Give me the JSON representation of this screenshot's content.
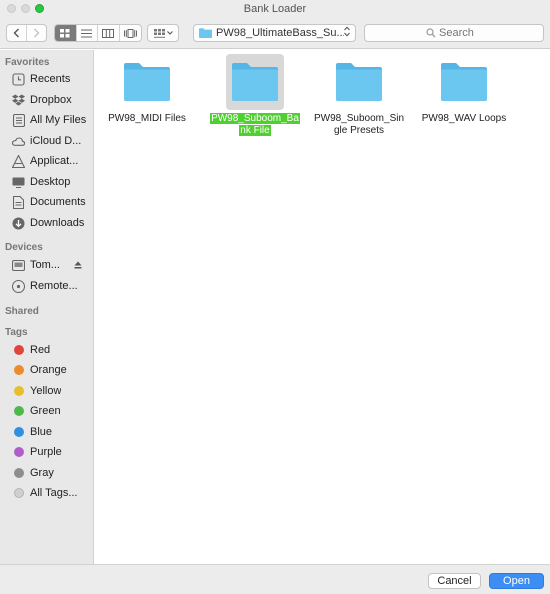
{
  "window": {
    "title": "Bank Loader"
  },
  "toolbar": {
    "back_icon": "chevron-left-icon",
    "forward_icon": "chevron-right-icon",
    "path_label": "PW98_UltimateBass_Su...",
    "search_placeholder": "Search"
  },
  "sidebar": {
    "favorites_heading": "Favorites",
    "favorites": [
      {
        "label": "Recents",
        "icon": "clock-icon"
      },
      {
        "label": "Dropbox",
        "icon": "dropbox-icon"
      },
      {
        "label": "All My Files",
        "icon": "files-icon"
      },
      {
        "label": "iCloud D...",
        "icon": "cloud-icon"
      },
      {
        "label": "Applicat...",
        "icon": "applications-icon"
      },
      {
        "label": "Desktop",
        "icon": "desktop-icon"
      },
      {
        "label": "Documents",
        "icon": "documents-icon"
      },
      {
        "label": "Downloads",
        "icon": "downloads-icon"
      }
    ],
    "devices_heading": "Devices",
    "devices": [
      {
        "label": "Tom...",
        "icon": "hard-drive-icon"
      },
      {
        "label": "Remote...",
        "icon": "disc-icon"
      }
    ],
    "shared_heading": "Shared",
    "tags_heading": "Tags",
    "tags": [
      {
        "label": "Red",
        "color": "#e0443b"
      },
      {
        "label": "Orange",
        "color": "#ed8a2b"
      },
      {
        "label": "Yellow",
        "color": "#e8be2c"
      },
      {
        "label": "Green",
        "color": "#4fb84a"
      },
      {
        "label": "Blue",
        "color": "#2f8fe0"
      },
      {
        "label": "Purple",
        "color": "#b05fc9"
      },
      {
        "label": "Gray",
        "color": "#8e8e8e"
      },
      {
        "label": "All Tags...",
        "color": "#cfcfcf"
      }
    ]
  },
  "files": [
    {
      "name_line1": "PW98_MIDI Files",
      "name_line2": "",
      "selected": false
    },
    {
      "name_line1": "PW98_Suboom_Ba",
      "name_line2": "nk File",
      "selected": true
    },
    {
      "name_line1": "PW98_Suboom_Sin",
      "name_line2": "gle Presets",
      "selected": false
    },
    {
      "name_line1": "PW98_WAV Loops",
      "name_line2": "",
      "selected": false
    }
  ],
  "footer": {
    "cancel_label": "Cancel",
    "open_label": "Open"
  },
  "colors": {
    "folder": "#6cc7f0",
    "folder_tab": "#55b6e6",
    "selection": "#4fd02e",
    "accent": "#3d8ef4"
  }
}
